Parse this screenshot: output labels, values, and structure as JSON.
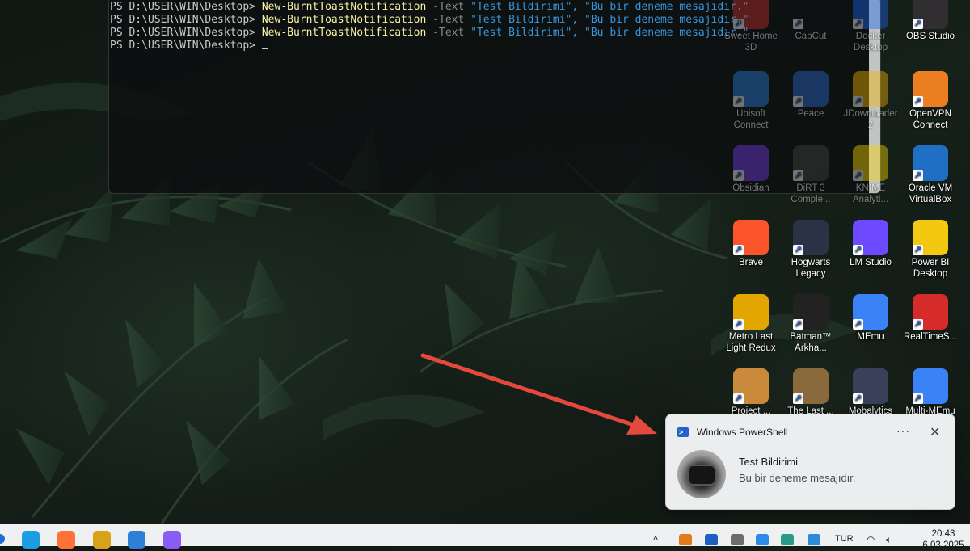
{
  "terminal": {
    "prompt": "PS D:\\USER\\WIN\\Desktop> ",
    "lines": [
      {
        "cmd": "New-BurntToastNotification",
        "param": " -Text ",
        "args": "\"Test Bildirimi\", \"Bu bir deneme mesajıdır.\""
      },
      {
        "cmd": "New-BurntToastNotification",
        "param": " -Text ",
        "args": "\"Test Bildirimi\", \"Bu bir deneme mesajıdır.\""
      },
      {
        "cmd": "New-BurntToastNotification",
        "param": " -Text ",
        "args": "\"Test Bildirimi\", \"Bu bir deneme mesajıdır.\""
      }
    ]
  },
  "desktop_icons": [
    {
      "label": "Sweet Home 3D",
      "icon": "sweet-home-3d-icon",
      "color": "#c9302c",
      "dim": true
    },
    {
      "label": "CapCut",
      "icon": "capcut-icon",
      "color": "#111111",
      "dim": true
    },
    {
      "label": "Docker Desktop",
      "icon": "docker-icon",
      "color": "#1d63ed",
      "dim": true
    },
    {
      "label": "OBS Studio",
      "icon": "obs-icon",
      "color": "#302e31",
      "dim": false
    },
    {
      "label": "Ubisoft Connect",
      "icon": "ubisoft-icon",
      "color": "#2a7de1",
      "dim": true
    },
    {
      "label": "Peace",
      "icon": "peace-icon",
      "color": "#2c6bd6",
      "dim": true
    },
    {
      "label": "JDownloader 2",
      "icon": "jdownloader-icon",
      "color": "#f4b400",
      "dim": true
    },
    {
      "label": "OpenVPN Connect",
      "icon": "openvpn-icon",
      "color": "#ea7e20",
      "dim": false
    },
    {
      "label": "Obsidian",
      "icon": "obsidian-icon",
      "color": "#7c3aed",
      "dim": true
    },
    {
      "label": "DiRT 3 Comple...",
      "icon": "dirt3-icon",
      "color": "#444444",
      "dim": true
    },
    {
      "label": "KNIME Analyti...",
      "icon": "knime-icon",
      "color": "#fdd800",
      "dim": true
    },
    {
      "label": "Oracle VM VirtualBox",
      "icon": "virtualbox-icon",
      "color": "#1f6fc5",
      "dim": false
    },
    {
      "label": "Brave",
      "icon": "brave-icon",
      "color": "#fb542b",
      "dim": false
    },
    {
      "label": "Hogwarts Legacy",
      "icon": "hogwarts-icon",
      "color": "#2a3346",
      "dim": false
    },
    {
      "label": "LM Studio",
      "icon": "lm-studio-icon",
      "color": "#6d4aff",
      "dim": false
    },
    {
      "label": "Power BI Desktop",
      "icon": "power-bi-icon",
      "color": "#f2c811",
      "dim": false
    },
    {
      "label": "Metro Last Light Redux",
      "icon": "metro-icon",
      "color": "#e2a600",
      "dim": false
    },
    {
      "label": "Batman™ Arkha...",
      "icon": "batman-icon",
      "color": "#222222",
      "dim": false
    },
    {
      "label": "MEmu",
      "icon": "memu-icon",
      "color": "#3b82f6",
      "dim": false
    },
    {
      "label": "RealTimeS...",
      "icon": "realtimesync-icon",
      "color": "#d62b2b",
      "dim": false
    },
    {
      "label": "Project ...",
      "icon": "project-icon",
      "color": "#c98a3c",
      "dim": false
    },
    {
      "label": "The Last ...",
      "icon": "the-last-icon",
      "color": "#8a6a3c",
      "dim": false
    },
    {
      "label": "Mobalytics",
      "icon": "mobalytics-icon",
      "color": "#3a3f5a",
      "dim": false
    },
    {
      "label": "Multi-MEmu",
      "icon": "multi-memu-icon",
      "color": "#3b82f6",
      "dim": false
    }
  ],
  "toast": {
    "app": "Windows PowerShell",
    "more": "···",
    "close": "✕",
    "title": "Test Bildirimi",
    "message": "Bu bir deneme mesajıdır."
  },
  "taskbar": {
    "apps": [
      {
        "icon": "edge-icon",
        "color": "#1b9de2"
      },
      {
        "icon": "firefox-icon",
        "color": "#ff7139"
      },
      {
        "icon": "winrar-icon",
        "color": "#d9a21b"
      },
      {
        "icon": "notepad-icon",
        "color": "#2f7fd6"
      },
      {
        "icon": "copilot-icon",
        "color": "#8a5cf6"
      }
    ],
    "tray": {
      "chevron": "^",
      "language": "TUR",
      "time": "20:43",
      "date": "6.03.2025"
    }
  }
}
